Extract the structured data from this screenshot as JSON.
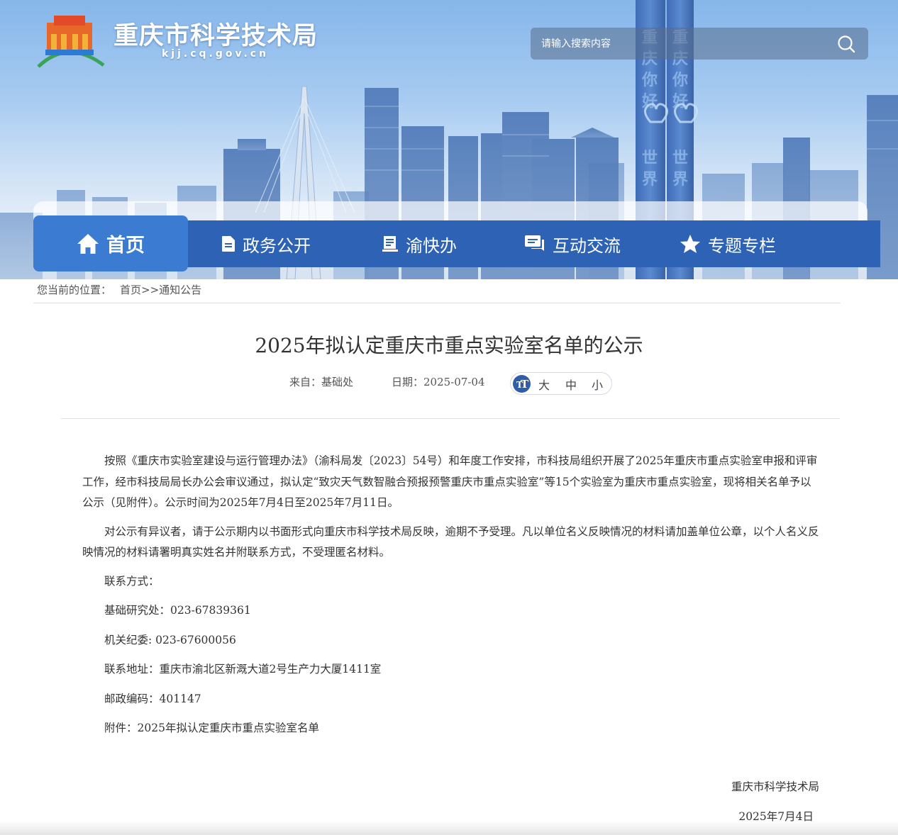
{
  "header": {
    "site_title": "重庆市科学技术局",
    "site_domain": "kjj.cq.gov.cn",
    "search_placeholder": "请输入搜索内容"
  },
  "nav": {
    "items": [
      {
        "label": "首页",
        "icon": "home-icon"
      },
      {
        "label": "政务公开",
        "icon": "document-icon"
      },
      {
        "label": "渝快办",
        "icon": "clipboard-icon"
      },
      {
        "label": "互动交流",
        "icon": "chat-icon"
      },
      {
        "label": "专题专栏",
        "icon": "star-icon"
      }
    ]
  },
  "breadcrumb": {
    "prefix": "您当前的位置：",
    "home": "首页",
    "separator": ">>",
    "current": "通知公告"
  },
  "article": {
    "title": "2025年拟认定重庆市重点实验室名单的公示",
    "from_label": "来自：基础处",
    "date_label": "日期：2025-07-04",
    "font_size": {
      "icon": "font-size-icon",
      "big": "大",
      "medium": "中",
      "small": "小"
    },
    "paragraphs": [
      "按照《重庆市实验室建设与运行管理办法》（渝科局发〔2023〕54号）和年度工作安排，市科技局组织开展了2025年重庆市重点实验室申报和评审工作，经市科技局局长办公会审议通过，拟认定“致灾天气数智融合预报预警重庆市重点实验室”等15个实验室为重庆市重点实验室，现将相关名单予以公示（见附件）。公示时间为2025年7月4日至2025年7月11日。",
      "对公示有异议者，请于公示期内以书面形式向重庆市科学技术局反映，逾期不予受理。凡以单位名义反映情况的材料请加盖单位公章，以个人名义反映情况的材料请署明真实姓名并附联系方式，不受理匿名材料。"
    ],
    "contact": {
      "heading": "联系方式：",
      "research_office": "基础研究处：023-67839361",
      "discipline": "机关纪委: 023-67600056",
      "address": "联系地址：重庆市渝北区新溉大道2号生产力大厦1411室",
      "postcode": "邮政编码：401147"
    },
    "attachment_prefix": "附件：",
    "attachment_link": "2025年拟认定重庆市重点实验室名单",
    "signature": "重庆市科学技术局",
    "signature_date": "2025年7月4日"
  },
  "colors": {
    "nav_bg": "#2d62b5",
    "nav_active": "#3b7bd2",
    "accent": "#2d62b5"
  }
}
